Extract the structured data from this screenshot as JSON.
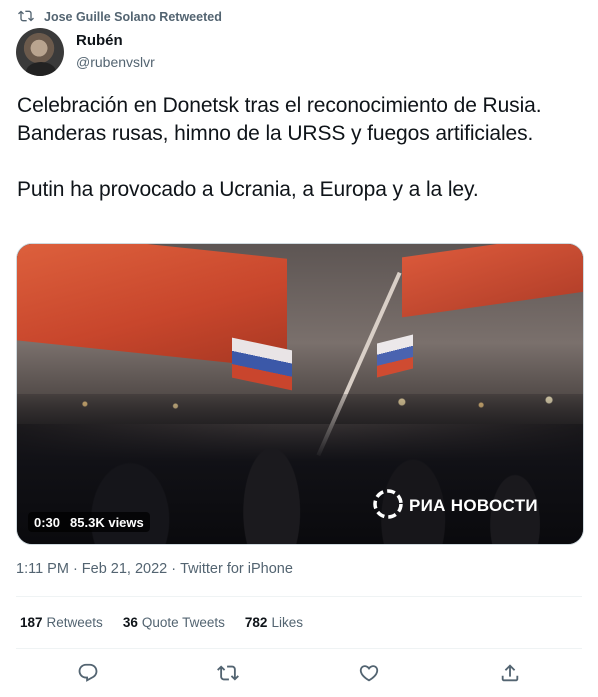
{
  "retweet_context": {
    "icon": "retweet-icon",
    "text": "Jose Guille Solano Retweeted"
  },
  "author": {
    "display_name": "Rubén",
    "handle": "@rubenvslvr"
  },
  "tweet": {
    "text": "Celebración en Donetsk tras el reconocimiento de Rusia. Banderas rusas, himno de la URSS y fuegos artificiales.\n\nPutin ha provocado a Ucrania, a Europa y a la ley."
  },
  "media": {
    "duration": "0:30",
    "views": "85.3K views",
    "watermark": "РИА НОВОСТИ"
  },
  "meta": {
    "time": "1:11 PM",
    "separator1": "·",
    "date": "Feb 21, 2022",
    "separator2": "·",
    "source": "Twitter for iPhone"
  },
  "stats": {
    "retweets_count": "187",
    "retweets_label": "Retweets",
    "quotes_count": "36",
    "quotes_label": "Quote Tweets",
    "likes_count": "782",
    "likes_label": "Likes"
  },
  "actions": {
    "reply_icon": "reply-icon",
    "retweet_icon": "retweet-icon",
    "like_icon": "heart-icon",
    "share_icon": "share-icon"
  },
  "colors": {
    "secondary_text": "#536471",
    "primary_text": "#0f1419",
    "divider": "#eff3f4"
  }
}
